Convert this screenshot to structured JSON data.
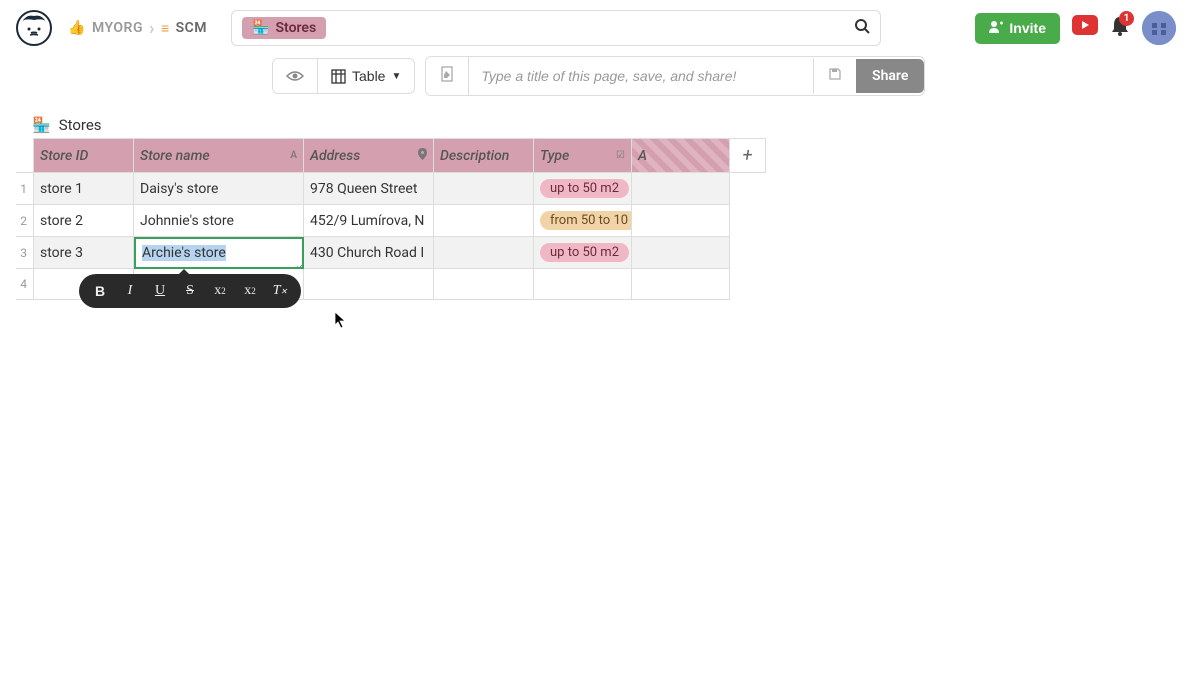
{
  "breadcrumb": {
    "org": "MYORG",
    "project": "SCM"
  },
  "search": {
    "tag": "Stores"
  },
  "header": {
    "invite": "Invite",
    "notif_count": "1"
  },
  "toolbar": {
    "table_label": "Table",
    "title_placeholder": "Type a title of this page, save, and share!",
    "share": "Share"
  },
  "table": {
    "title": "Stores",
    "columns": {
      "c0": "Store ID",
      "c1": "Store name",
      "c2": "Address",
      "c3": "Description",
      "c4": "Type",
      "c5": "A"
    },
    "col_type_icons": {
      "c1": "A",
      "c2": "📍",
      "c4": "▾"
    },
    "rows": [
      {
        "n": "1",
        "id": "store 1",
        "name": "Daisy's store",
        "addr": "978 Queen Street",
        "desc": "",
        "type": "up to 50 m2",
        "type_color": "pink"
      },
      {
        "n": "2",
        "id": "store 2",
        "name": "Johnnie's store",
        "addr": "452/9 Lumírova, N",
        "desc": "",
        "type": "from 50 to 10",
        "type_color": "orange"
      },
      {
        "n": "3",
        "id": "store 3",
        "name": "Archie's store",
        "addr": "430 Church Road I",
        "desc": "",
        "type": "up to 50 m2",
        "type_color": "pink"
      }
    ],
    "empty_row": "4"
  },
  "fmt": {
    "bold": "B",
    "ital": "I",
    "under": "U",
    "strike": "S",
    "sub": "x",
    "sub2": "2",
    "sup": "x",
    "sup2": "2",
    "clear": "T"
  }
}
